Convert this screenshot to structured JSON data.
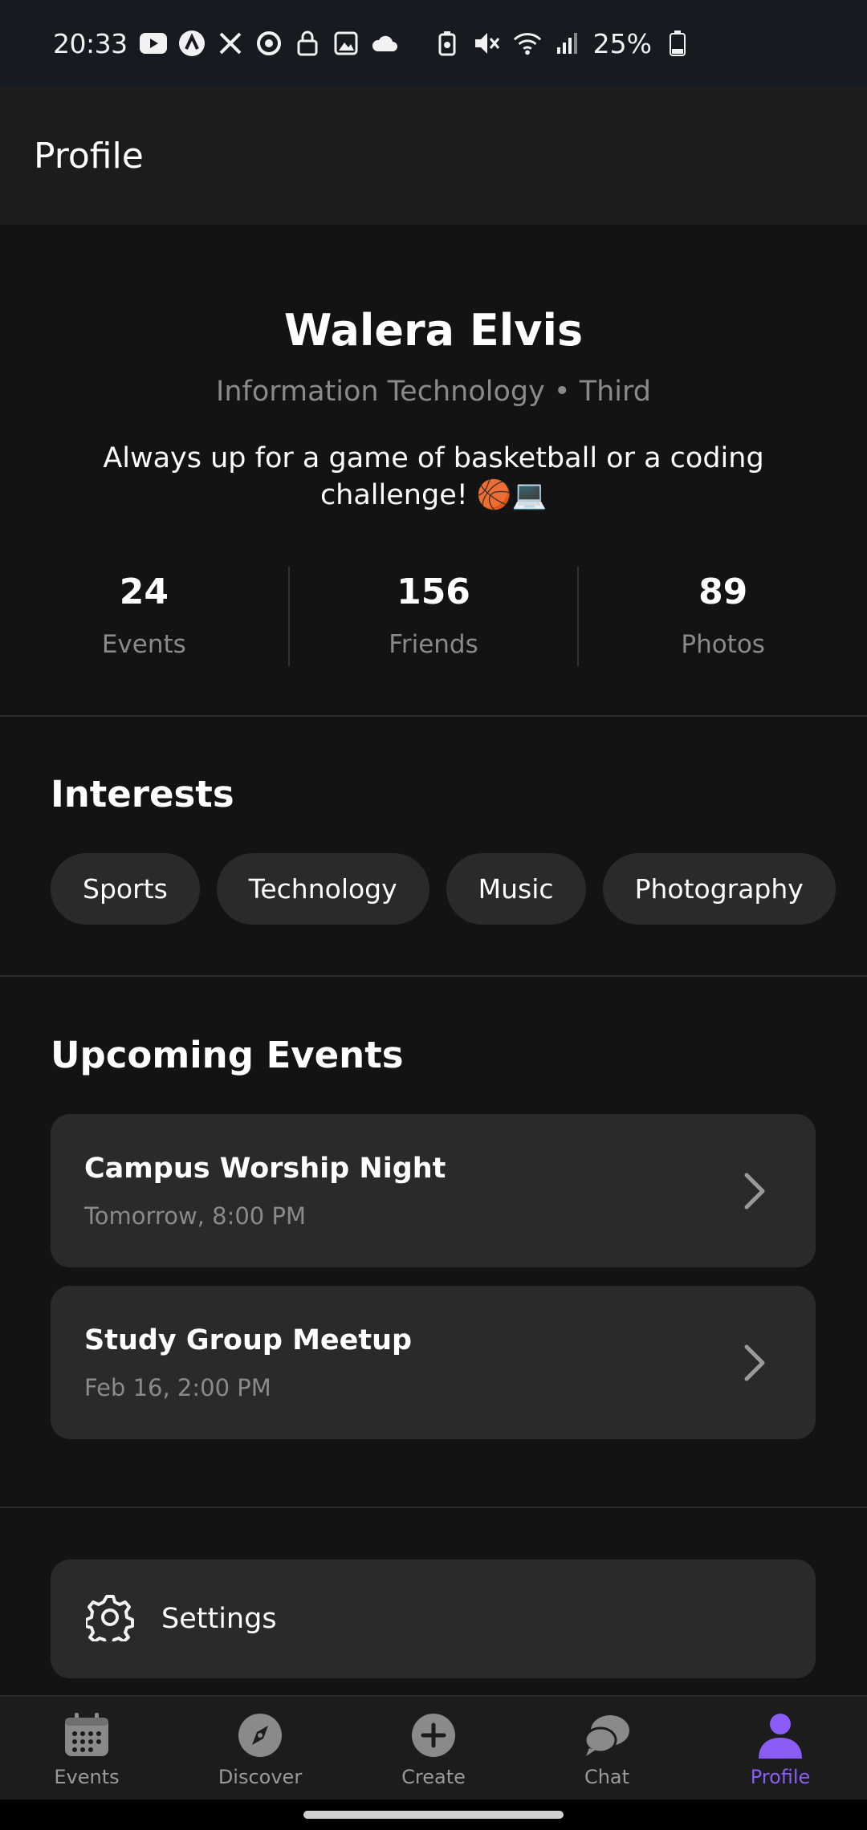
{
  "status_bar": {
    "time": "20:33",
    "battery": "25%",
    "left_icons": [
      "youtube-icon",
      "a-icon",
      "x-icon",
      "circle-arrow-icon",
      "lock-icon",
      "image-icon",
      "cloud-icon"
    ],
    "right_icons": [
      "battery-saver-icon",
      "mute-icon",
      "wifi-icon",
      "signal-icon",
      "battery-icon"
    ]
  },
  "header": {
    "title": "Profile"
  },
  "profile": {
    "name": "Walera Elvis",
    "subtitle": "Information Technology • Third",
    "bio": "Always up for a game of basketball or a coding challenge! 🏀💻"
  },
  "stats": [
    {
      "value": "24",
      "label": "Events"
    },
    {
      "value": "156",
      "label": "Friends"
    },
    {
      "value": "89",
      "label": "Photos"
    }
  ],
  "interests": {
    "title": "Interests",
    "items": [
      "Sports",
      "Technology",
      "Music",
      "Photography"
    ]
  },
  "upcoming": {
    "title": "Upcoming Events",
    "events": [
      {
        "title": "Campus Worship Night",
        "time": "Tomorrow, 8:00 PM"
      },
      {
        "title": "Study Group Meetup",
        "time": "Feb 16, 2:00 PM"
      }
    ]
  },
  "settings": {
    "label": "Settings"
  },
  "nav": {
    "items": [
      {
        "label": "Events",
        "icon": "calendar-icon"
      },
      {
        "label": "Discover",
        "icon": "compass-icon"
      },
      {
        "label": "Create",
        "icon": "plus-circle-icon"
      },
      {
        "label": "Chat",
        "icon": "chat-icon"
      },
      {
        "label": "Profile",
        "icon": "person-icon"
      }
    ],
    "active": "Profile",
    "accent": "#8b5cf6",
    "inactive_color": "#9a9a9a"
  }
}
